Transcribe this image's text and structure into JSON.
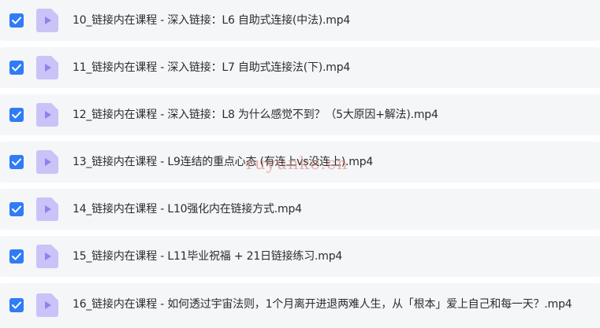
{
  "files": [
    {
      "name": "10_链接内在课程 - 深入链接：L6 自助式连接(中法).mp4",
      "checked": true
    },
    {
      "name": "11_链接内在课程 - 深入链接：L7 自助式连接法(下).mp4",
      "checked": true
    },
    {
      "name": "12_链接内在课程 - 深入链接：L8 为什么感觉不到？（5大原因+解法).mp4",
      "checked": true
    },
    {
      "name": "13_链接内在课程 - L9连结的重点心态 (有连上vs没连上).mp4",
      "checked": true
    },
    {
      "name": "14_链接内在课程 - L10强化内在链接方式.mp4",
      "checked": true
    },
    {
      "name": "15_链接内在课程 - L11毕业祝福 + 21日链接练习.mp4",
      "checked": true
    },
    {
      "name": "16_链接内在课程 - 如何透过宇宙法则，1个月离开进退两难人生，从「根本」爱上自己和每一天？.mp4",
      "checked": true
    }
  ],
  "watermark": "ruyunke.cn",
  "colors": {
    "checkbox": "#2f7cf6",
    "file_icon": "#c9c3f8",
    "file_icon_play": "#8b83ee",
    "row_bg": "#f5f6f8"
  }
}
